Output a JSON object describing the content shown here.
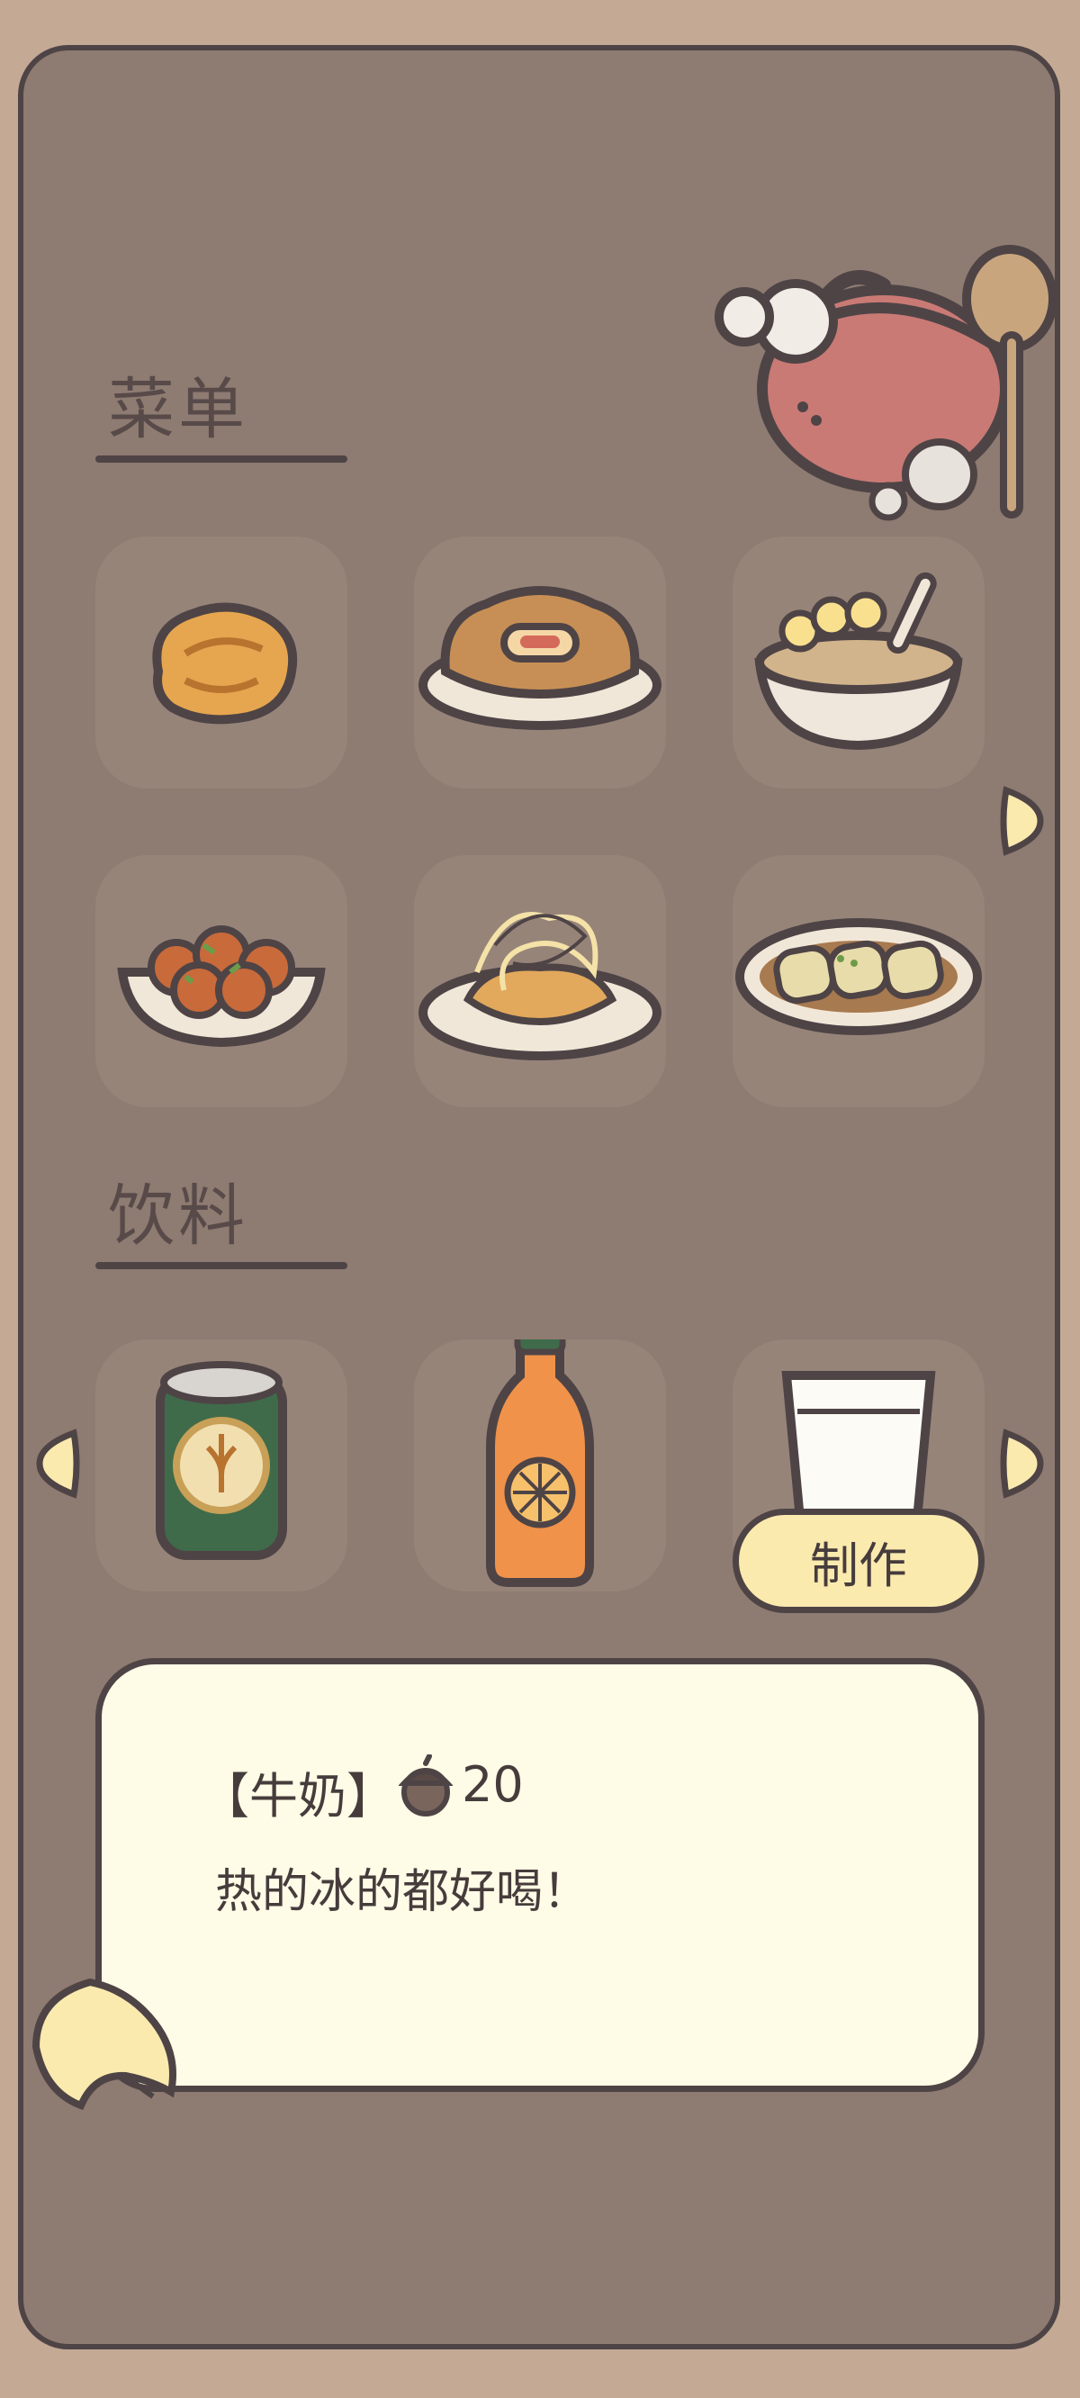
{
  "menu": {
    "title": "菜单",
    "items": [
      {
        "icon": "fried-cake-icon"
      },
      {
        "icon": "flower-cake-plate-icon"
      },
      {
        "icon": "dessert-bowl-icon"
      },
      {
        "icon": "takoyaki-plate-icon"
      },
      {
        "icon": "noodle-plate-icon"
      },
      {
        "icon": "rice-rolls-plate-icon"
      }
    ]
  },
  "drinks": {
    "title": "饮料",
    "items": [
      {
        "icon": "beer-can-icon"
      },
      {
        "icon": "orange-soda-bottle-icon"
      },
      {
        "icon": "milk-glass-icon"
      }
    ]
  },
  "make_button": "制作",
  "detail": {
    "name": "【牛奶】",
    "price": "20",
    "currency_icon": "acorn-icon",
    "description": "热的冰的都好喝！"
  },
  "colors": {
    "background": "#c4a995",
    "panel": "#8e7b71",
    "outline": "#4e4446",
    "button": "#fbeaae",
    "dialog": "#fefbe6"
  }
}
